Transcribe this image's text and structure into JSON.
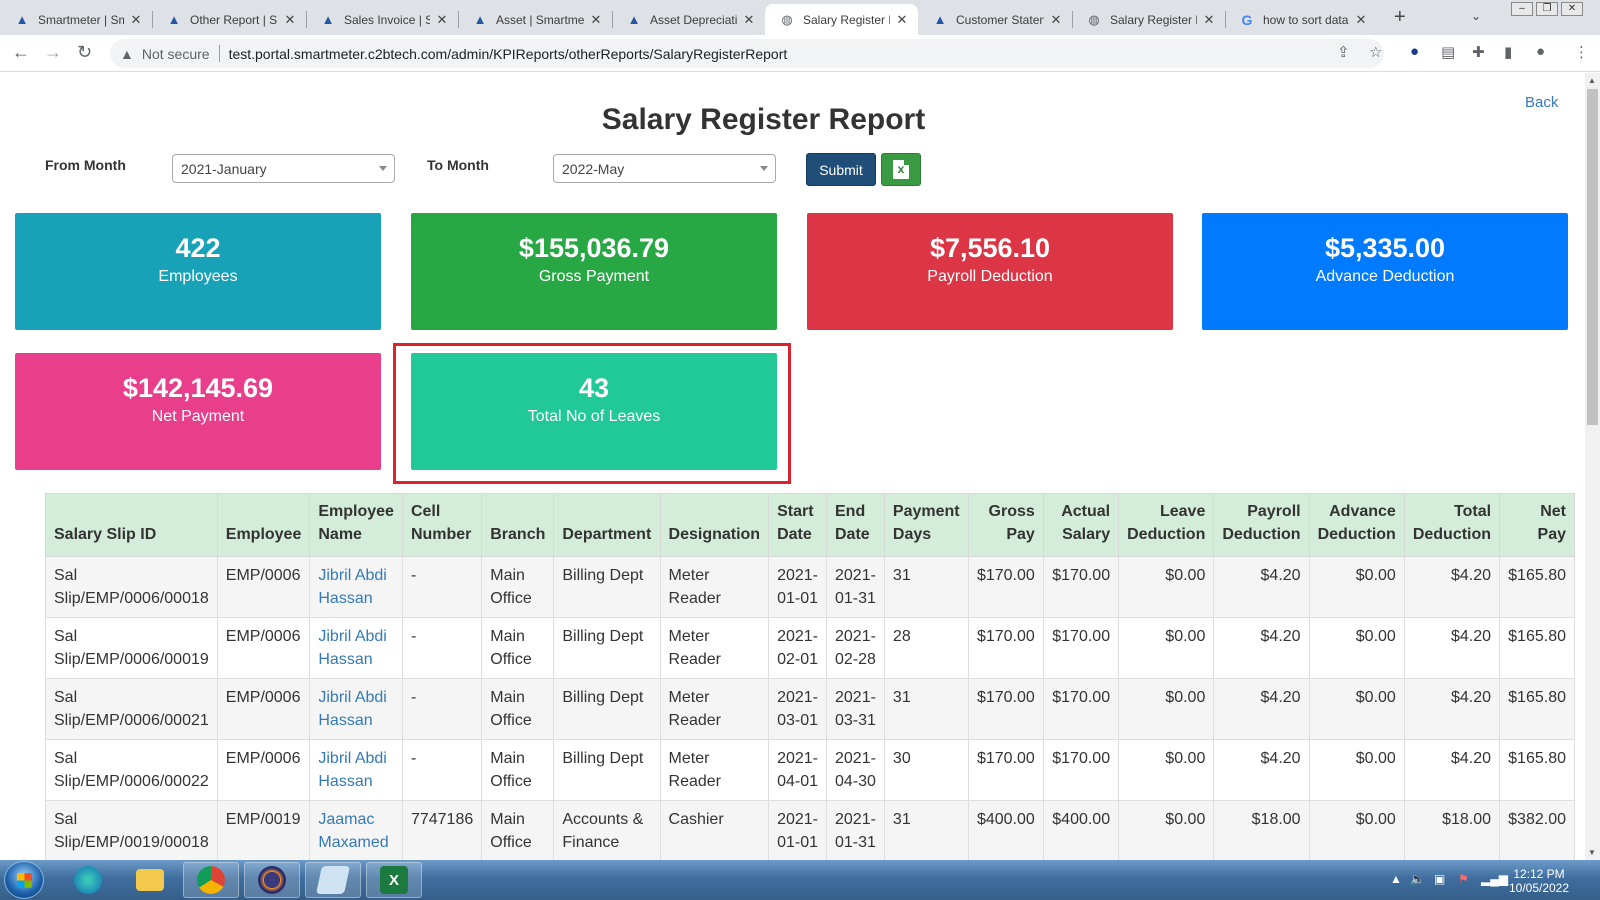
{
  "browser": {
    "tabs": [
      {
        "title": "Smartmeter | Sm",
        "icon": "drop-icon",
        "active": false
      },
      {
        "title": "Other Report | S",
        "icon": "drop-icon",
        "active": false
      },
      {
        "title": "Sales Invoice | Sr",
        "icon": "drop-icon",
        "active": false
      },
      {
        "title": "Asset | Smartme",
        "icon": "drop-icon",
        "active": false
      },
      {
        "title": "Asset Depreciati",
        "icon": "drop-icon",
        "active": false
      },
      {
        "title": "Salary Register F",
        "icon": "globe-icon",
        "active": true
      },
      {
        "title": "Customer Staten",
        "icon": "drop-icon",
        "active": false
      },
      {
        "title": "Salary Register F",
        "icon": "globe-icon",
        "active": false
      },
      {
        "title": "how to sort data",
        "icon": "google-icon",
        "active": false
      }
    ],
    "security_text": "Not secure",
    "url": "test.portal.smartmeter.c2btech.com/admin/KPIReports/otherReports/SalaryRegisterReport"
  },
  "page": {
    "title": "Salary Register Report",
    "back_label": "Back"
  },
  "filters": {
    "from_label": "From Month",
    "from_value": "2021-January",
    "to_label": "To Month",
    "to_value": "2022-May",
    "submit_label": "Submit"
  },
  "cards": [
    {
      "value": "422",
      "label": "Employees",
      "color": "#17a2b8"
    },
    {
      "value": "$155,036.79",
      "label": "Gross Payment",
      "color": "#28a745"
    },
    {
      "value": "$7,556.10",
      "label": "Payroll Deduction",
      "color": "#dc3545"
    },
    {
      "value": "$5,335.00",
      "label": "Advance Deduction",
      "color": "#007bff"
    },
    {
      "value": "$142,145.69",
      "label": "Net Payment",
      "color": "#e83e8c"
    },
    {
      "value": "43",
      "label": "Total No of Leaves",
      "color": "#20c997"
    }
  ],
  "table": {
    "headers": [
      "Salary Slip ID",
      "Employee",
      "Employee Name",
      "Cell Number",
      "Branch",
      "Department",
      "Designation",
      "Start Date",
      "End Date",
      "Payment Days",
      "Gross Pay",
      "Actual Salary",
      "Leave Deduction",
      "Payroll Deduction",
      "Advance Deduction",
      "Total Deduction",
      "Net Pay"
    ],
    "rows": [
      [
        "Sal Slip/EMP/0006/00018",
        "EMP/0006",
        "Jibril Abdi Hassan",
        "-",
        "Main Office",
        "Billing Dept",
        "Meter Reader",
        "2021-01-01",
        "2021-01-31",
        "31",
        "$170.00",
        "$170.00",
        "$0.00",
        "$4.20",
        "$0.00",
        "$4.20",
        "$165.80"
      ],
      [
        "Sal Slip/EMP/0006/00019",
        "EMP/0006",
        "Jibril Abdi Hassan",
        "-",
        "Main Office",
        "Billing Dept",
        "Meter Reader",
        "2021-02-01",
        "2021-02-28",
        "28",
        "$170.00",
        "$170.00",
        "$0.00",
        "$4.20",
        "$0.00",
        "$4.20",
        "$165.80"
      ],
      [
        "Sal Slip/EMP/0006/00021",
        "EMP/0006",
        "Jibril Abdi Hassan",
        "-",
        "Main Office",
        "Billing Dept",
        "Meter Reader",
        "2021-03-01",
        "2021-03-31",
        "31",
        "$170.00",
        "$170.00",
        "$0.00",
        "$4.20",
        "$0.00",
        "$4.20",
        "$165.80"
      ],
      [
        "Sal Slip/EMP/0006/00022",
        "EMP/0006",
        "Jibril Abdi Hassan",
        "-",
        "Main Office",
        "Billing Dept",
        "Meter Reader",
        "2021-04-01",
        "2021-04-30",
        "30",
        "$170.00",
        "$170.00",
        "$0.00",
        "$4.20",
        "$0.00",
        "$4.20",
        "$165.80"
      ],
      [
        "Sal Slip/EMP/0019/00018",
        "EMP/0019",
        "Jaamac Maxamed",
        "7747186",
        "Main Office",
        "Accounts & Finance",
        "Cashier",
        "2021-01-01",
        "2021-01-31",
        "31",
        "$400.00",
        "$400.00",
        "$0.00",
        "$18.00",
        "$0.00",
        "$18.00",
        "$382.00"
      ]
    ]
  },
  "taskbar": {
    "time": "12:12 PM",
    "date": "10/05/2022"
  }
}
